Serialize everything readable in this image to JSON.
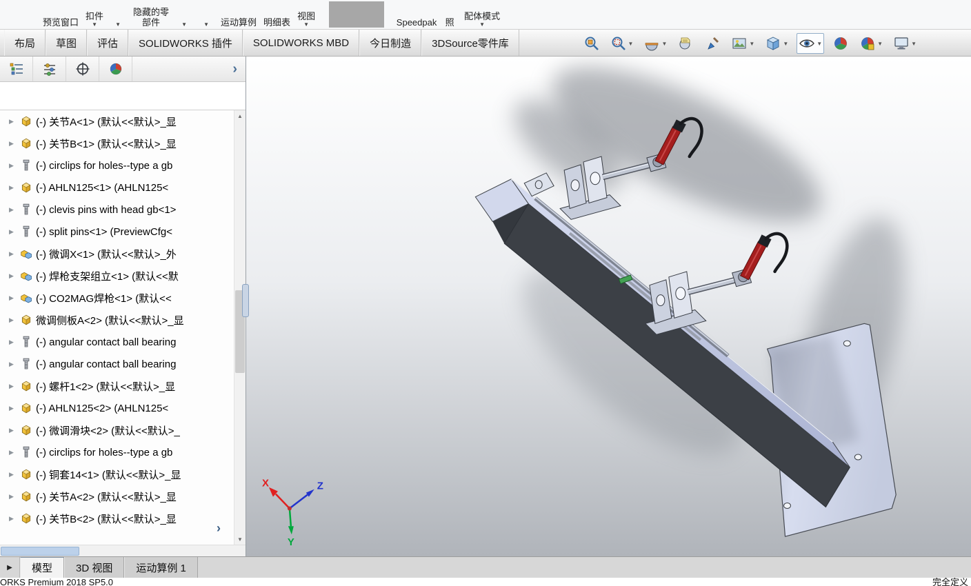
{
  "colors": {
    "torch_red": "#a51e1e",
    "beam_dark": "#3c4046",
    "beam_light": "#c9d0e8",
    "axis_x": "#e02020",
    "axis_y": "#00a83c",
    "axis_z": "#2233cc",
    "viewport_bottom": "#b0b4ba"
  },
  "ribbon": {
    "items_a": [
      {
        "label": "预览窗口",
        "caret": false
      },
      {
        "label": "扣件",
        "caret": true
      },
      {
        "label": "",
        "caret": true
      },
      {
        "label": "隐藏的零部件",
        "caret": false
      },
      {
        "label": "",
        "caret": true
      },
      {
        "label": "",
        "caret": true
      },
      {
        "label": "运动算例",
        "caret": false
      },
      {
        "label": "明细表",
        "caret": false
      },
      {
        "label": "视图",
        "caret": true
      }
    ],
    "items_b": [
      {
        "label": "Speedpak",
        "caret": false
      },
      {
        "label": "照",
        "caret": false
      },
      {
        "label": "配体模式",
        "caret": true
      }
    ]
  },
  "command_tabs": [
    {
      "label": "布局"
    },
    {
      "label": "草图"
    },
    {
      "label": "评估"
    },
    {
      "label": "SOLIDWORKS 插件"
    },
    {
      "label": "SOLIDWORKS MBD"
    },
    {
      "label": "今日制造"
    },
    {
      "label": "3DSource零件库"
    }
  ],
  "headsup": {
    "caret_glyph": "▼",
    "icons": [
      {
        "btn": "zoom-fit-button",
        "icon": "zoom-fit",
        "caret": false,
        "active": false
      },
      {
        "btn": "zoom-area-button",
        "icon": "zoom-area",
        "caret": true,
        "active": false
      },
      {
        "btn": "section-view-button",
        "icon": "section-view",
        "caret": true,
        "active": false
      },
      {
        "btn": "annotation-view-button",
        "icon": "annotation-view",
        "caret": false,
        "active": false
      },
      {
        "btn": "edit-appearance-button",
        "icon": "edit-appearance",
        "caret": false,
        "active": false
      },
      {
        "btn": "apply-scene-button",
        "icon": "apply-scene",
        "caret": true,
        "active": false
      },
      {
        "btn": "view-orientation-button",
        "icon": "view-cube",
        "caret": true,
        "active": false
      },
      {
        "btn": "hide-show-items-button",
        "icon": "eye",
        "caret": true,
        "active": true
      },
      {
        "btn": "appearance-ball-button",
        "icon": "colorball",
        "caret": false,
        "active": false
      },
      {
        "btn": "scene-ball-button",
        "icon": "scene-ball",
        "caret": true,
        "active": false
      },
      {
        "btn": "view-settings-button",
        "icon": "monitor",
        "caret": true,
        "active": false
      }
    ]
  },
  "panel": {
    "flyout_arrow": "›",
    "expand_arrow": "›",
    "scroll_up": "▲",
    "scroll_down": "▼",
    "tabs": [
      {
        "btn": "featuremanager-tab",
        "icon": "featuremanager"
      },
      {
        "btn": "propertymanager-tab",
        "icon": "propertymanager"
      },
      {
        "btn": "configurationmanager-tab",
        "icon": "configurationmanager"
      },
      {
        "btn": "displaymanager-tab",
        "icon": "displaymanager"
      }
    ]
  },
  "feature_tree": {
    "expand_glyph": "▶",
    "items": [
      {
        "icon": "part",
        "label": "(-) 关节A<1> (默认<<默认>_显"
      },
      {
        "icon": "part",
        "label": "(-) 关节B<1> (默认<<默认>_显"
      },
      {
        "icon": "bolt",
        "label": "(-) circlips for holes--type a gb"
      },
      {
        "icon": "part",
        "label": "(-) AHLN125<1> (AHLN125<"
      },
      {
        "icon": "bolt",
        "label": "(-) clevis pins with head gb<1>"
      },
      {
        "icon": "bolt",
        "label": "(-) split pins<1> (PreviewCfg<"
      },
      {
        "icon": "asm",
        "label": "(-) 微调X<1> (默认<<默认>_外"
      },
      {
        "icon": "asm",
        "label": "(-) 焊枪支架组立<1> (默认<<默"
      },
      {
        "icon": "asm",
        "label": "(-) CO2MAG焊枪<1> (默认<<"
      },
      {
        "icon": "part",
        "label": "微调侧板A<2> (默认<<默认>_显"
      },
      {
        "icon": "bolt",
        "label": "(-) angular contact ball bearing"
      },
      {
        "icon": "bolt",
        "label": "(-) angular contact ball bearing"
      },
      {
        "icon": "part",
        "label": "(-) 螺杆1<2> (默认<<默认>_显"
      },
      {
        "icon": "part",
        "label": "(-) AHLN125<2> (AHLN125<"
      },
      {
        "icon": "part",
        "label": "(-) 微调滑块<2> (默认<<默认>_"
      },
      {
        "icon": "bolt",
        "label": "(-) circlips for holes--type a gb"
      },
      {
        "icon": "part",
        "label": "(-) 铜套14<1> (默认<<默认>_显"
      },
      {
        "icon": "part",
        "label": "(-) 关节A<2> (默认<<默认>_显"
      },
      {
        "icon": "part",
        "label": "(-) 关节B<2> (默认<<默认>_显"
      }
    ]
  },
  "viewport": {
    "triad": {
      "x": "X",
      "y": "Y",
      "z": "Z"
    }
  },
  "bottom_bar": {
    "nav_glyph": "▶",
    "tabs": [
      {
        "label": "模型",
        "active": true
      },
      {
        "label": "3D 视图",
        "active": false
      },
      {
        "label": "运动算例 1",
        "active": false
      }
    ]
  },
  "status_bar": {
    "left": "ORKS Premium 2018 SP5.0",
    "right": "完全定义"
  }
}
